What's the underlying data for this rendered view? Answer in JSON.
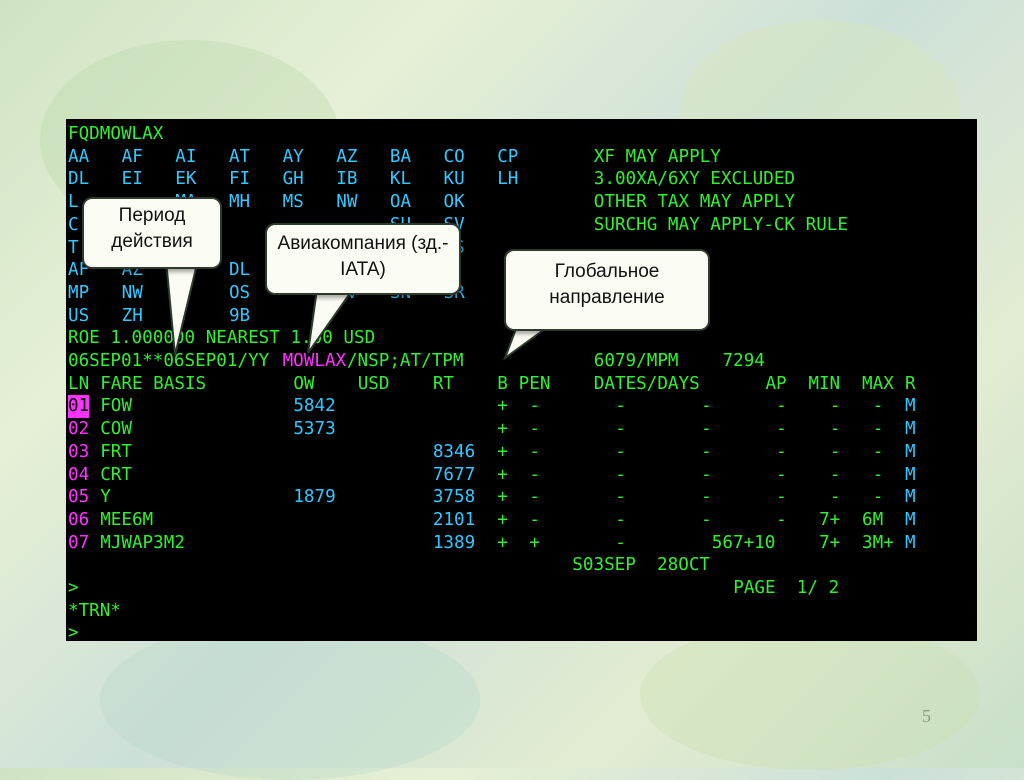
{
  "terminal": {
    "command": "FQDMOWLAX",
    "carrier_rows": [
      [
        "AA",
        "AF",
        "AI",
        "AT",
        "AY",
        "AZ",
        "BA",
        "CO",
        "CP"
      ],
      [
        "DL",
        "EI",
        "EK",
        "FI",
        "GH",
        "IB",
        "KL",
        "KU",
        "LH"
      ],
      [
        "L",
        "",
        "MA",
        "MH",
        "MS",
        "NW",
        "OA",
        "OK",
        ""
      ],
      [
        "C",
        "",
        "SK",
        "",
        "",
        "",
        "SU",
        "SV",
        ""
      ],
      [
        "T",
        "",
        "UN",
        "",
        "",
        "",
        "AA",
        "OS",
        ""
      ],
      [
        "AF",
        "AZ",
        "A",
        "DL",
        "",
        "",
        "LH",
        "",
        ""
      ],
      [
        "MP",
        "NW",
        "Z",
        "OS",
        "",
        "RV",
        "SN",
        "SR",
        ""
      ],
      [
        "US",
        "ZH",
        "G",
        "9B",
        "",
        "",
        "",
        "",
        ""
      ]
    ],
    "notes": [
      "XF MAY APPLY",
      "3.00XA/6XY EXCLUDED",
      "OTHER TAX MAY APPLY",
      "SURCHG MAY APPLY-CK RULE"
    ],
    "roe_line": "ROE 1.000000 NEAREST 1.00 USD",
    "routing_line": {
      "dates": "06SEP01**06SEP01/YY",
      "city_pair": "MOWLAX",
      "rest": "/NSP;AT/TPM",
      "tpm": "6079/MPM",
      "mpm": "7294"
    },
    "headers": {
      "ln": "LN",
      "fare_basis": "FARE BASIS",
      "ow": "OW",
      "currency": "USD",
      "rt": "RT",
      "b": "B",
      "pen": "PEN",
      "dates": "DATES/DAYS",
      "ap": "AP",
      "min": "MIN",
      "max": "MAX",
      "r": "R"
    },
    "fares": [
      {
        "ln": "01",
        "basis": "FOW",
        "ow": "5842",
        "rt": "",
        "b": "+",
        "pen": "-",
        "dates": "-",
        "days": "-",
        "ap": "-",
        "min": "-",
        "max": "-",
        "r": "M"
      },
      {
        "ln": "02",
        "basis": "COW",
        "ow": "5373",
        "rt": "",
        "b": "+",
        "pen": "-",
        "dates": "-",
        "days": "-",
        "ap": "-",
        "min": "-",
        "max": "-",
        "r": "M"
      },
      {
        "ln": "03",
        "basis": "FRT",
        "ow": "",
        "rt": "8346",
        "b": "+",
        "pen": "-",
        "dates": "-",
        "days": "-",
        "ap": "-",
        "min": "-",
        "max": "-",
        "r": "M"
      },
      {
        "ln": "04",
        "basis": "CRT",
        "ow": "",
        "rt": "7677",
        "b": "+",
        "pen": "-",
        "dates": "-",
        "days": "-",
        "ap": "-",
        "min": "-",
        "max": "-",
        "r": "M"
      },
      {
        "ln": "05",
        "basis": "Y",
        "ow": "1879",
        "rt": "3758",
        "b": "+",
        "pen": "-",
        "dates": "-",
        "days": "-",
        "ap": "-",
        "min": "-",
        "max": "-",
        "r": "M"
      },
      {
        "ln": "06",
        "basis": "MEE6M",
        "ow": "",
        "rt": "2101",
        "b": "+",
        "pen": "-",
        "dates": "-",
        "days": "-",
        "ap": "-",
        "min": "7+",
        "max": "6M",
        "r": "M"
      },
      {
        "ln": "07",
        "basis": "MJWAP3M2",
        "ow": "",
        "rt": "1389",
        "b": "+",
        "pen": "+",
        "dates": "-",
        "days": "567+10",
        "ap": "",
        "min": "7+",
        "max": "3M+",
        "r": "M"
      }
    ],
    "seasonal_line": "S03SEP  28OCT",
    "prompt1": ">",
    "page_line": "PAGE  1/ 2",
    "trn_line": "*TRN*",
    "prompt2": ">"
  },
  "callouts": {
    "validity": "Период действия",
    "airline": "Авиакомпания (зд.- IATA)",
    "direction": "Глобальное направление"
  },
  "slide_number": "5",
  "colors": {
    "green": "#33ee33",
    "blue": "#33c8ff",
    "magenta": "#ff33ff",
    "background": "#000000"
  }
}
